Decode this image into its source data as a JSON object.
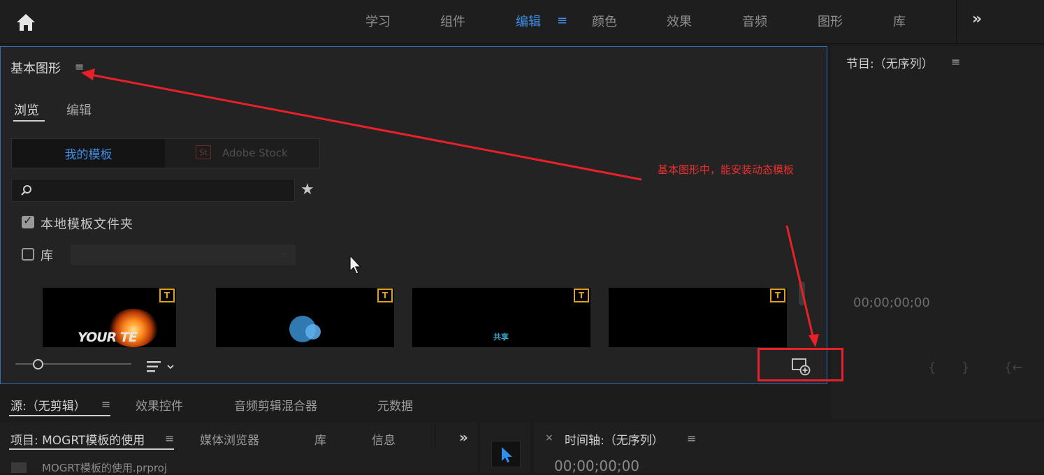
{
  "workspace_bar": {
    "tabs": [
      "学习",
      "组件",
      "编辑",
      "颜色",
      "效果",
      "音频",
      "图形",
      "库"
    ],
    "active_tab": "编辑",
    "menu_glyph": "≡",
    "more_glyph": "»"
  },
  "essential_graphics": {
    "title": "基本图形",
    "menu_glyph": "≡",
    "tabs": {
      "browse": "浏览",
      "edit": "编辑"
    },
    "segments": {
      "mine": "我的模板",
      "stock_logo": "St",
      "stock": "Adobe Stock"
    },
    "search_placeholder": "",
    "star_glyph": "★",
    "checkboxes": {
      "local_label": "本地模板文件夹",
      "local_checked": true,
      "local_mark": "✓",
      "lib_label": "库",
      "lib_checked": false
    },
    "dropdown_arrow": "⌄",
    "thumbnails": [
      {
        "badge": "T",
        "text": "YOUR TE"
      },
      {
        "badge": "T",
        "text": ""
      },
      {
        "badge": "T",
        "text": "共享"
      },
      {
        "badge": "T",
        "text": ""
      }
    ]
  },
  "annotation": {
    "text": "基本图形中，能安装动态模板",
    "color": "#e8202a"
  },
  "program_monitor": {
    "title": "节目:（无序列）",
    "menu_glyph": "≡",
    "timecode": "00;00;00;00",
    "controls": [
      "{",
      "}",
      "{←"
    ]
  },
  "source_row": {
    "active_tab": "源:（无剪辑）",
    "menu_glyph": "≡",
    "tabs": [
      "效果控件",
      "音频剪辑混合器",
      "元数据"
    ]
  },
  "project_row": {
    "active_tab": "项目: MOGRT模板的使用",
    "menu_glyph": "≡",
    "tabs": [
      "媒体浏览器",
      "库",
      "信息"
    ],
    "more_glyph": "»",
    "file_name": "MOGRT模板的使用.prproj"
  },
  "timeline": {
    "close_glyph": "×",
    "title": "时间轴:（无序列）",
    "menu_glyph": "≡",
    "timecode": "00;00;00;00"
  },
  "colors": {
    "accent_blue": "#3f8fe8",
    "badge_orange": "#e0a020",
    "panel_bg": "#232323"
  }
}
